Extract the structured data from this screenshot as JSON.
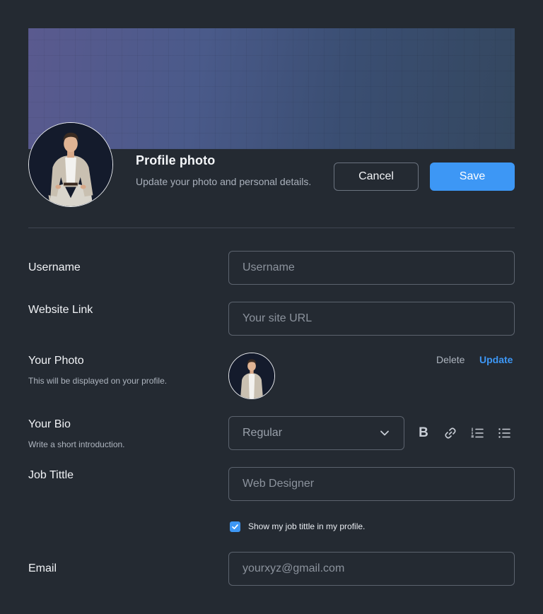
{
  "header": {
    "title": "Profile photo",
    "subtitle": "Update your photo and personal details.",
    "cancel_label": "Cancel",
    "save_label": "Save"
  },
  "form": {
    "username": {
      "label": "Username",
      "value": "",
      "placeholder": "Username"
    },
    "website": {
      "label": "Website Link",
      "value": "",
      "placeholder": "Your site URL"
    },
    "photo": {
      "label": "Your Photo",
      "hint": "This will be displayed on your profile.",
      "delete_label": "Delete",
      "update_label": "Update"
    },
    "bio": {
      "label": "Your Bio",
      "hint": "Write a short introduction.",
      "format_selected": "Regular",
      "toolbar": [
        "bold-icon",
        "link-icon",
        "ordered-list-icon",
        "bullet-list-icon"
      ],
      "bold_glyph": "B"
    },
    "job": {
      "label": "Job Tittle",
      "value": "",
      "placeholder": "Web Designer",
      "show_in_profile_checked": true,
      "show_in_profile_label": "Show my job tittle in my profile."
    },
    "email": {
      "label": "Email",
      "value": "",
      "placeholder": "yourxyz@gmail.com"
    }
  },
  "colors": {
    "background": "#242a32",
    "accent": "#3d97f5",
    "border": "#5c636e",
    "muted_text": "#aeb5bf"
  }
}
